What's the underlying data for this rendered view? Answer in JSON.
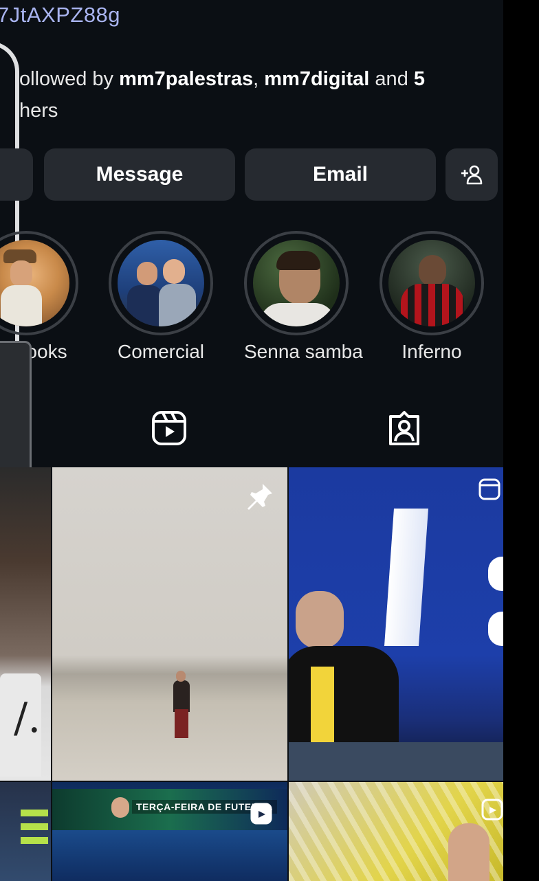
{
  "profile": {
    "link_text": "7JtAXPZ88g",
    "followed_prefix": "ollowed by ",
    "follower_1": "mm7palestras",
    "separator": ", ",
    "follower_2": "mm7digital",
    "followed_suffix_1": " and ",
    "followed_count": "5",
    "followed_line2": "hers"
  },
  "actions": {
    "message_label": "Message",
    "email_label": "Email",
    "add_user_icon": "add-person-icon"
  },
  "highlights": [
    {
      "label": "ooks"
    },
    {
      "label": "Comercial"
    },
    {
      "label": "Senna samba"
    },
    {
      "label": "Inferno"
    }
  ],
  "tabs": {
    "reels_icon": "reels-icon",
    "tagged_icon": "tagged-person-icon"
  },
  "grid": {
    "post_5_caption": "TERÇA-FEIRA DE FUTEBOL"
  },
  "colors": {
    "background": "#0b0f14",
    "button": "#262a30",
    "link": "#a9b4f0",
    "ring": "#3b3f45"
  }
}
